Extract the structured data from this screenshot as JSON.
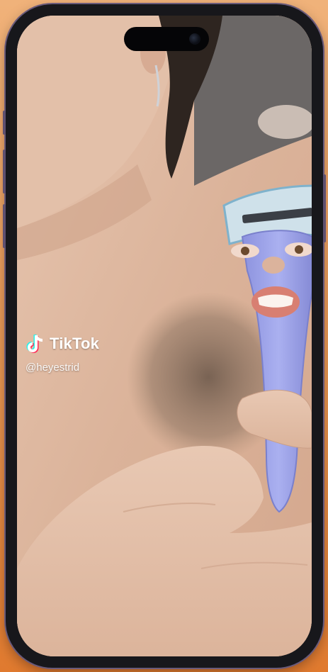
{
  "watermark": {
    "brand": "TikTok",
    "username": "@heyestrid",
    "logo_icon": "tiktok-note-icon"
  },
  "colors": {
    "background": "#e9944f",
    "phone_frame": "#17171b",
    "razor_handle": "#9aa0e6",
    "watermark_text": "#ffffff"
  }
}
